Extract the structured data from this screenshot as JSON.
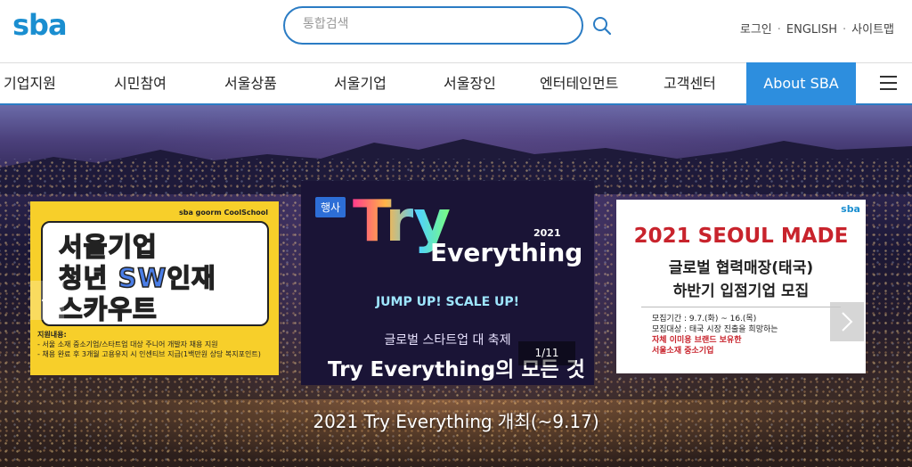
{
  "header": {
    "logo": "sba",
    "search_placeholder": "통합검색",
    "util_links": [
      "로그인",
      "ENGLISH",
      "사이트맵"
    ]
  },
  "nav": {
    "items": [
      "기업지원",
      "시민참여",
      "서울상품",
      "서울기업",
      "서울장인",
      "엔터테인먼트",
      "고객센터"
    ],
    "highlight": "About SBA",
    "accent_color": "#2d8ede"
  },
  "hero": {
    "caption": "2021 Try Everything 개최(~9.17)",
    "pager": "1/11",
    "left_card": {
      "brand": "sba  goorm  CoolSchool",
      "title_lines": [
        "서울기업",
        "청년 SW인재",
        "스카우트"
      ],
      "info_title": "지원내용:",
      "info_lines": [
        "- 서울 소재 중소기업/스타트업 대상 주니어 개발자 채용 지원",
        "- 채용 완료 후 3개월 고용유지 시 인센티브 지급(1백만원 상당 복지포인트)"
      ]
    },
    "center_card": {
      "badge": "행사",
      "try": "Try",
      "year": "2021",
      "everything": "Everything",
      "jump": "JUMP UP! SCALE UP!",
      "sub": "글로벌 스타트업 대 축제",
      "sub2": "Try Everything의 모든 것"
    },
    "right_card": {
      "brand": "sba",
      "title": "2021 SEOUL MADE",
      "line1": "글로벌 협력매장(태국)",
      "line2": "하반기 입점기업 모집",
      "info": [
        "모집기간 : 9.7.(화) ~ 16.(목)",
        "모집대상 : 태국 시장 진출을 희망하는",
        "자체 이미용 브랜드 보유한",
        "서울소재 중소기업"
      ]
    }
  }
}
